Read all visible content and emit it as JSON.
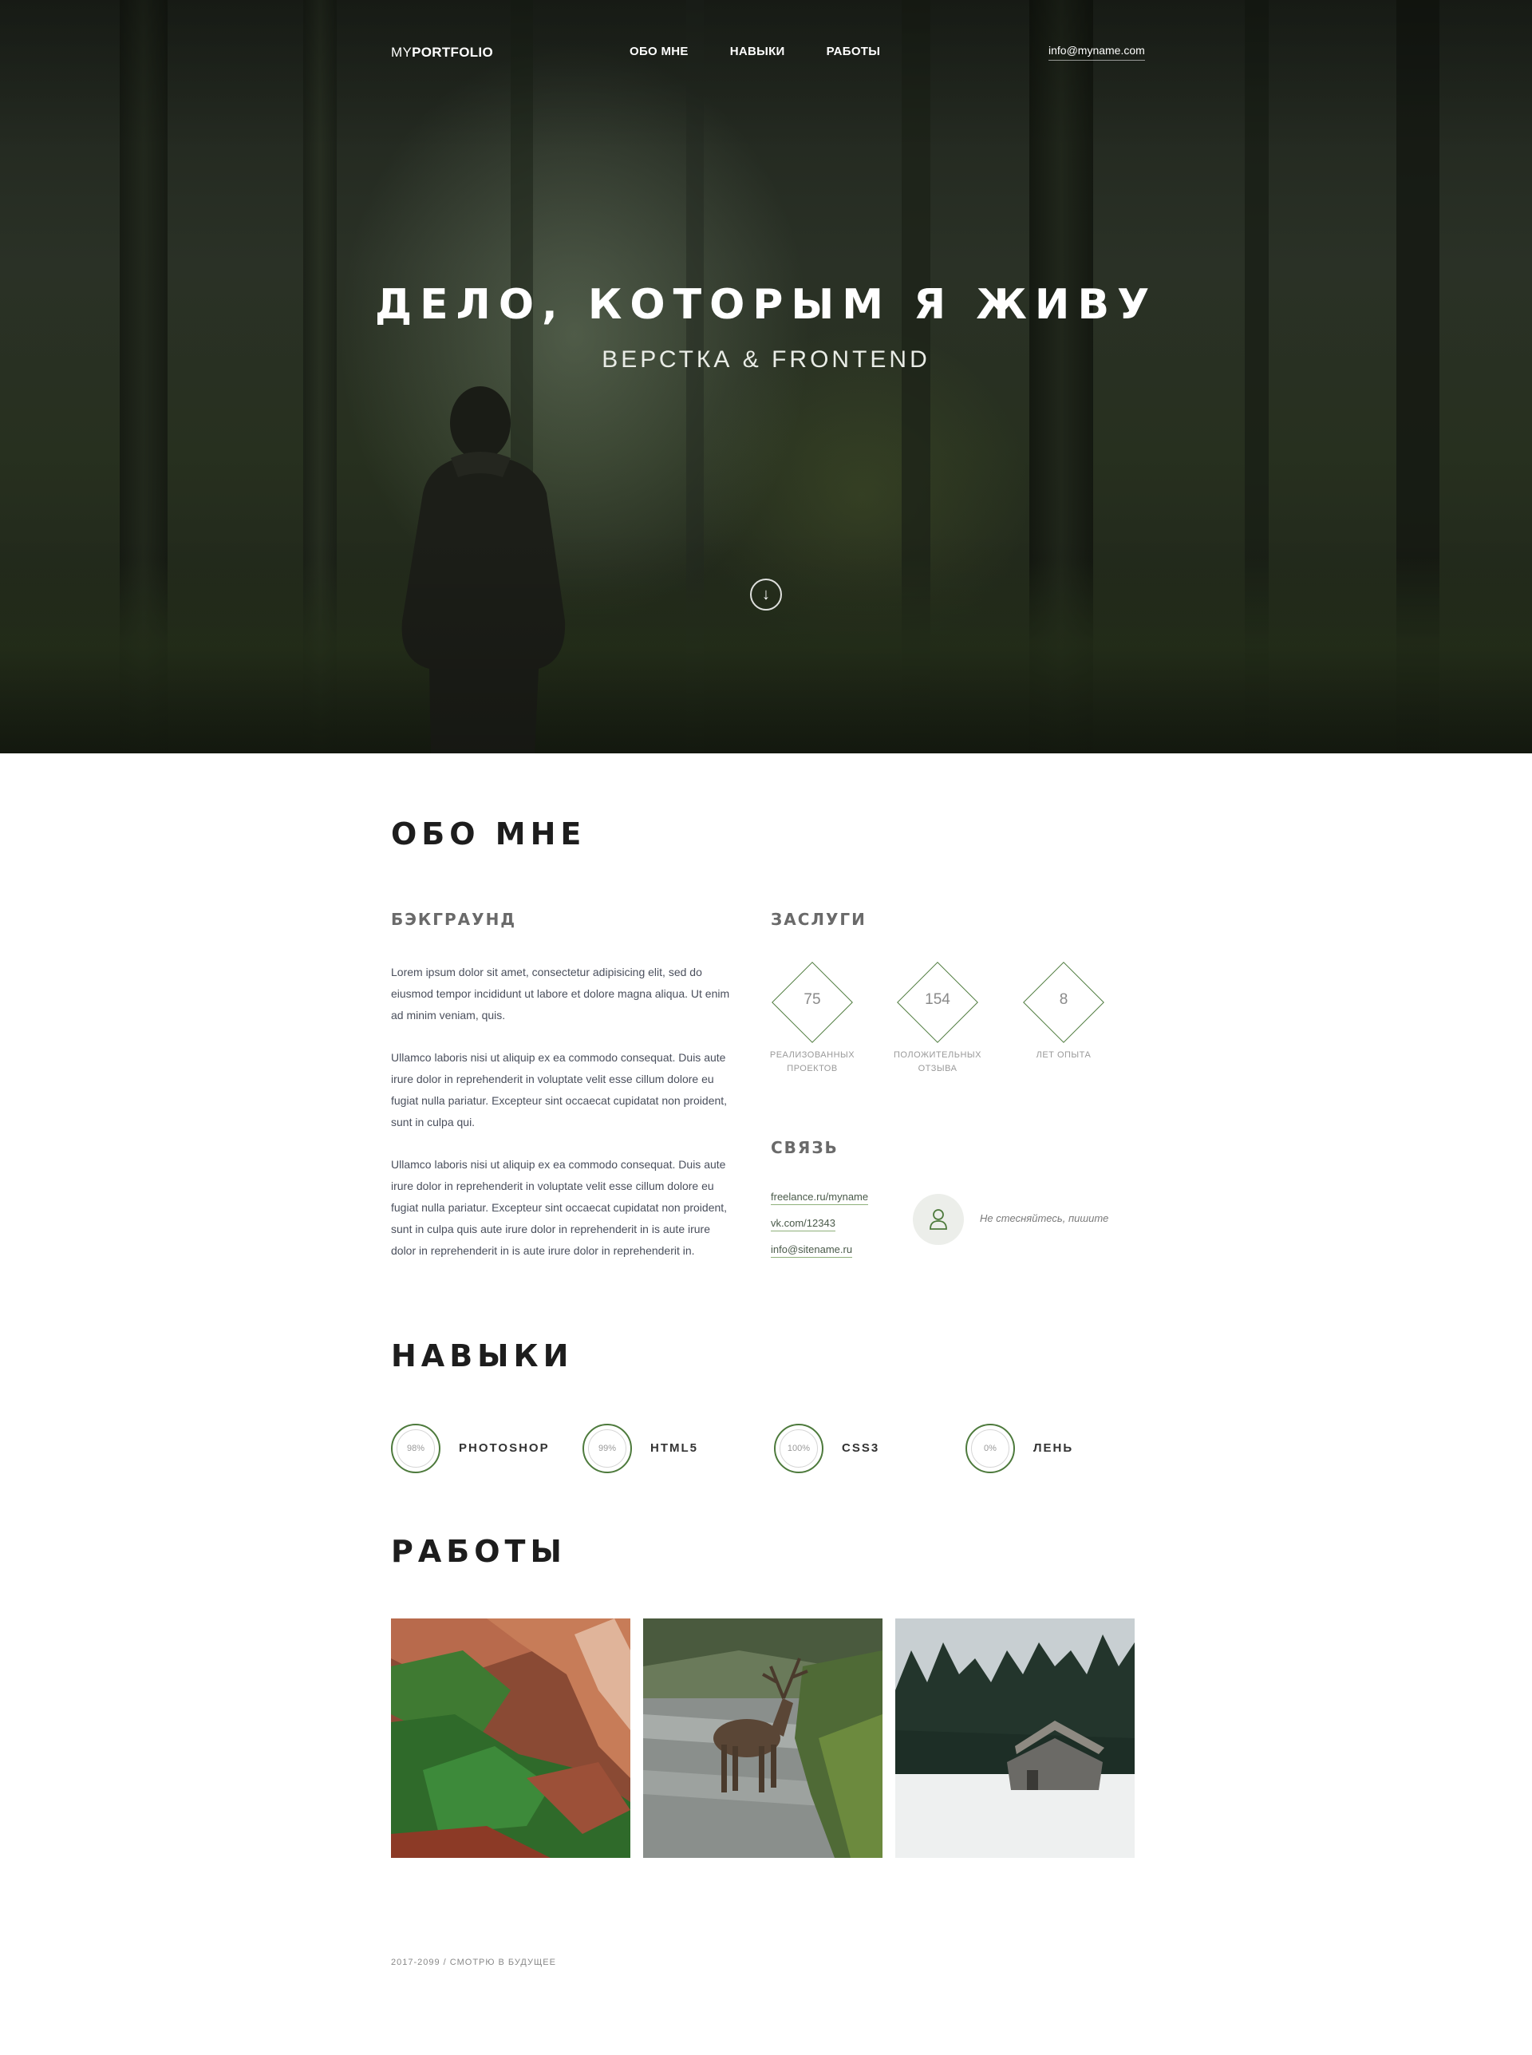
{
  "nav": {
    "logo_light": "MY",
    "logo_bold": "PORTFOLIO",
    "items": [
      {
        "label": "ОБО МНЕ"
      },
      {
        "label": "НАВЫКИ"
      },
      {
        "label": "РАБОТЫ"
      }
    ],
    "email": "info@myname.com"
  },
  "hero": {
    "title": "ДЕЛО, КОТОРЫМ Я ЖИВУ",
    "subtitle": "ВЕРСТКА & FRONTEND",
    "scroll_icon": "arrow-down-icon"
  },
  "about": {
    "title": "ОБО МНЕ",
    "background_title": "БЭКГРАУНД",
    "paragraphs": [
      "Lorem ipsum dolor sit amet, consectetur adipisicing elit, sed do eiusmod tempor incididunt ut labore et dolore magna aliqua. Ut enim ad minim veniam, quis.",
      "Ullamco laboris nisi ut aliquip ex ea commodo consequat. Duis aute irure dolor in reprehenderit in voluptate velit esse cillum dolore eu fugiat nulla pariatur. Excepteur sint occaecat cupidatat non proident, sunt in culpa qui.",
      "Ullamco laboris nisi ut aliquip ex ea commodo consequat. Duis aute irure dolor in reprehenderit in voluptate velit esse cillum dolore eu fugiat nulla pariatur. Excepteur sint occaecat cupidatat non proident, sunt in culpa quis aute irure dolor in reprehenderit in is aute irure dolor in reprehenderit in is aute irure dolor in reprehenderit in."
    ],
    "merits_title": "ЗАСЛУГИ",
    "stats": [
      {
        "value": "75",
        "label_line1": "РЕАЛИЗОВАННЫХ",
        "label_line2": "ПРОЕКТОВ"
      },
      {
        "value": "154",
        "label_line1": "ПОЛОЖИТЕЛЬНЫХ",
        "label_line2": "ОТЗЫВА"
      },
      {
        "value": "8",
        "label_line1": "ЛЕТ ОПЫТА",
        "label_line2": ""
      }
    ],
    "contact_title": "СВЯЗЬ",
    "contacts": [
      "freelance.ru/myname",
      "vk.com/12343",
      "info@sitename.ru"
    ],
    "contact_note": "Не стесняйтесь, пишите",
    "avatar_icon": "user-icon"
  },
  "skills": {
    "title": "НАВЫКИ",
    "items": [
      {
        "percent": "98%",
        "name": "PHOTOSHOP",
        "level": 0.98
      },
      {
        "percent": "99%",
        "name": "HTML5",
        "level": 0.99
      },
      {
        "percent": "100%",
        "name": "CSS3",
        "level": 1.0
      },
      {
        "percent": "0%",
        "name": "ЛЕНЬ",
        "level": 0.0
      }
    ]
  },
  "works": {
    "title": "РАБОТЫ",
    "items": [
      {
        "name": "canyon-photo"
      },
      {
        "name": "deer-photo"
      },
      {
        "name": "cabin-photo"
      }
    ]
  },
  "footer": {
    "text": "2017-2099 / СМОТРЮ В БУДУЩЕЕ"
  },
  "colors": {
    "accent": "#4d7a3c",
    "text_dark": "#1d1d1d",
    "text_muted": "#9a9a9a"
  }
}
